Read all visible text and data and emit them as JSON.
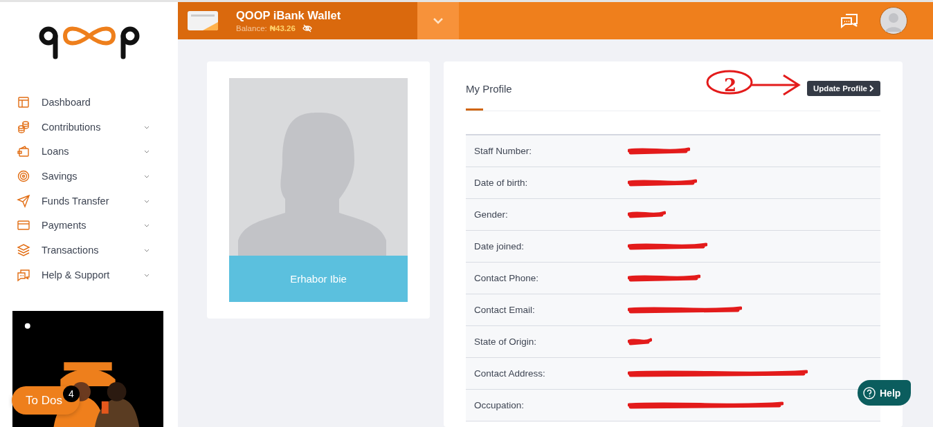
{
  "sidebar": {
    "items": [
      {
        "label": "Dashboard",
        "expandable": false
      },
      {
        "label": "Contributions",
        "expandable": true
      },
      {
        "label": "Loans",
        "expandable": true
      },
      {
        "label": "Savings",
        "expandable": true
      },
      {
        "label": "Funds Transfer",
        "expandable": true
      },
      {
        "label": "Payments",
        "expandable": true
      },
      {
        "label": "Transactions",
        "expandable": true
      },
      {
        "label": "Help & Support",
        "expandable": true
      }
    ]
  },
  "topbar": {
    "wallet_title": "QOOP iBank Wallet",
    "balance_label": "Balance:",
    "balance": "₦43.26"
  },
  "photo_card": {
    "name": "Erhabor Ibie"
  },
  "profile": {
    "title": "My Profile",
    "button": "Update Profile",
    "annotation": {
      "label": "2"
    },
    "rows": [
      {
        "label": "Staff Number:",
        "redacted": true
      },
      {
        "label": "Date of birth:",
        "redacted": true
      },
      {
        "label": "Gender:",
        "redacted": true
      },
      {
        "label": "Date joined:",
        "redacted": true
      },
      {
        "label": "Contact Phone:",
        "redacted": true
      },
      {
        "label": "Contact Email:",
        "redacted": true
      },
      {
        "label": "State of Origin:",
        "redacted": true
      },
      {
        "label": "Contact Address:",
        "redacted": true
      },
      {
        "label": "Occupation:",
        "redacted": true
      }
    ]
  },
  "todos": {
    "label": "To Dos",
    "count": "4"
  },
  "help": {
    "label": "Help"
  }
}
